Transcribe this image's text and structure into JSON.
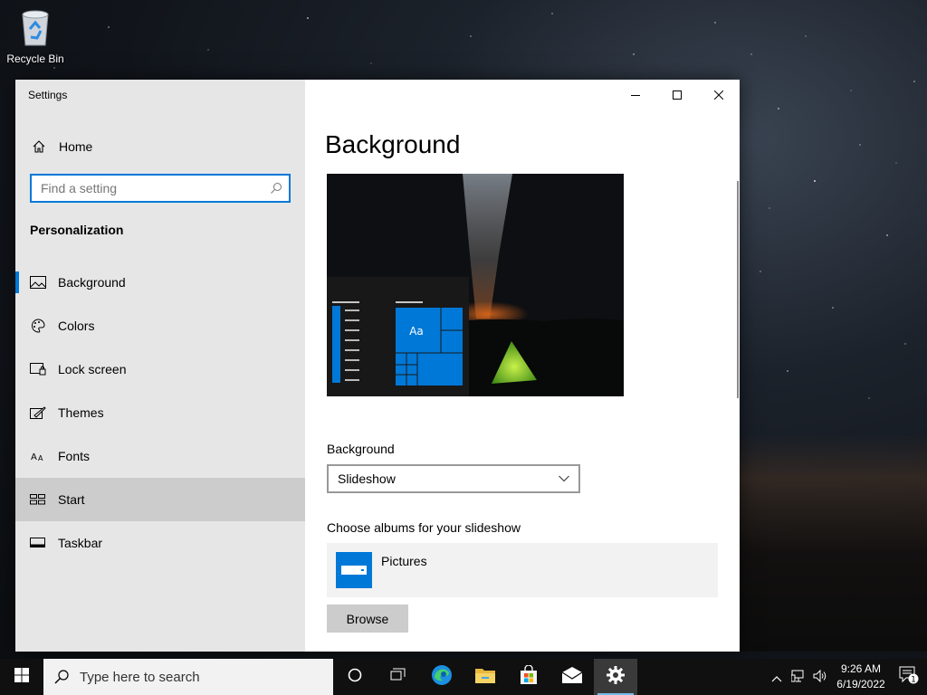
{
  "desktop": {
    "icons": [
      {
        "label": "Recycle Bin",
        "icon": "recycle-bin-icon"
      }
    ]
  },
  "window": {
    "title": "Settings",
    "caption": {
      "minimize": "minimize-icon",
      "maximize": "maximize-icon",
      "close": "close-icon"
    }
  },
  "sidebar": {
    "home_label": "Home",
    "search_placeholder": "Find a setting",
    "section_title": "Personalization",
    "items": [
      {
        "label": "Background",
        "icon": "picture-icon",
        "selected": true
      },
      {
        "label": "Colors",
        "icon": "palette-icon"
      },
      {
        "label": "Lock screen",
        "icon": "lock-screen-icon"
      },
      {
        "label": "Themes",
        "icon": "brush-icon"
      },
      {
        "label": "Fonts",
        "icon": "font-icon"
      },
      {
        "label": "Start",
        "icon": "start-icon",
        "hovered": true
      },
      {
        "label": "Taskbar",
        "icon": "taskbar-icon"
      }
    ]
  },
  "main": {
    "page_title": "Background",
    "preview": {
      "tile_text": "Aa"
    },
    "background_label": "Background",
    "background_value": "Slideshow",
    "albums_label": "Choose albums for your slideshow",
    "album_name": "Pictures",
    "browse_label": "Browse"
  },
  "taskbar": {
    "search_placeholder": "Type here to search",
    "apps": [
      "cortana-icon",
      "task-view-icon",
      "edge-icon",
      "file-explorer-icon",
      "store-icon",
      "mail-icon",
      "settings-icon"
    ],
    "active_app": "settings-icon",
    "time": "9:26 AM",
    "date": "6/19/2022",
    "notification_count": "1"
  },
  "colors": {
    "accent": "#0078d7",
    "sidebar_bg": "#e6e6e6",
    "taskbar_bg": "#101010"
  }
}
